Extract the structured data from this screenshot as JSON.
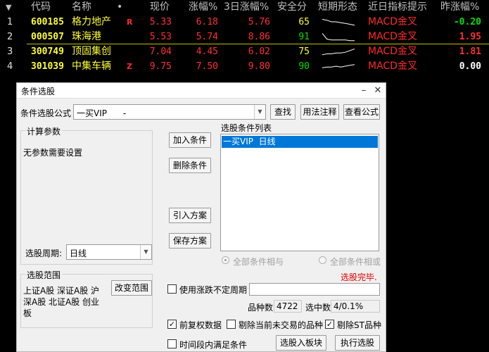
{
  "table": {
    "headers": {
      "sort": "▼",
      "code": "代码",
      "name": "名称",
      "dot": "•",
      "price": "现价",
      "chg": "涨幅%",
      "chg3": "3日涨幅%",
      "safe": "安全分",
      "trend": "短期形态",
      "indicator": "近日指标提示",
      "yest": "昨涨幅%"
    },
    "rows": [
      {
        "idx": "1",
        "code": "600185",
        "name": "格力地产",
        "flag": "R",
        "price": "5.33",
        "chg": "6.18",
        "chg3": "5.76",
        "safe": "65",
        "indicator": "MACD金叉",
        "yest": "-0.20",
        "yest_color": "#00e000",
        "name_color": "#ffff30"
      },
      {
        "idx": "2",
        "code": "000507",
        "name": "珠海港",
        "flag": "",
        "price": "5.53",
        "chg": "5.74",
        "chg3": "8.86",
        "safe": "91",
        "indicator": "MACD金叉",
        "yest": "1.95",
        "yest_color": "#ff3030",
        "name_color": "#ffff30"
      },
      {
        "idx": "3",
        "code": "300749",
        "name": "顶固集创",
        "flag": "",
        "price": "7.04",
        "chg": "4.45",
        "chg3": "6.02",
        "safe": "75",
        "indicator": "MACD金叉",
        "yest": "1.81",
        "yest_color": "#ff3030",
        "name_color": "#ffff30"
      },
      {
        "idx": "4",
        "code": "301039",
        "name": "中集车辆",
        "flag": "Z",
        "price": "9.75",
        "chg": "7.50",
        "chg3": "9.80",
        "safe": "90",
        "indicator": "MACD金叉",
        "yest": "0.00",
        "yest_color": "#ffffff",
        "name_color": "#ffff30"
      }
    ],
    "sparklines": [
      [
        3,
        4,
        6,
        6,
        7,
        8,
        9,
        10
      ],
      [
        2,
        9,
        10,
        10,
        10,
        10,
        11,
        11
      ],
      [
        10,
        9,
        9,
        8,
        8,
        7,
        5,
        3
      ],
      [
        8,
        7,
        7,
        6,
        7,
        6,
        5,
        4
      ]
    ],
    "colors": {
      "up": "#ff3030",
      "code": "#ffff30",
      "safe_good": "#00e000",
      "safe_mid": "#ffff30",
      "indicator": "#ff2a2a"
    }
  },
  "dialog": {
    "title": "条件选股",
    "minimize": "–",
    "close": "✕",
    "formula_label": "条件选股公式",
    "formula_value": "一买VIP      -",
    "find_button": "查找",
    "usage_button": "用法注释",
    "view_button": "查看公式",
    "params_group": "计算参数",
    "params_text": "无参数需要设置",
    "period_label": "选股周期:",
    "period_value": "日线",
    "add_button": "加入条件",
    "delete_button": "删除条件",
    "import_button": "引入方案",
    "save_button": "保存方案",
    "list_group": "选股条件列表",
    "list_items": [
      "一买VIP  日线"
    ],
    "radio_and": "全部条件相与",
    "radio_or": "全部条件相或",
    "status": "选股完毕.",
    "range_group": "选股范围",
    "range_line1": "上证A股 深证A股 沪",
    "range_line2": "深A股 北证A股 创业",
    "range_line3": "板",
    "change_range_button": "改变范围",
    "use_uncertain_label": "使用涨跌不定周期",
    "count_label": "品种数",
    "count_value": "4722",
    "selected_label": "选中数",
    "selected_value": "4/0.1%",
    "prerights_label": "前复权数据",
    "exclude_untraded_label": "剔除当前未交易的品种",
    "exclude_st_label": "剔除ST品种",
    "time_range_label": "时间段内满足条件",
    "add_to_block_button": "选股入板块",
    "execute_button": "执行选股",
    "checks": {
      "use_uncertain": false,
      "prerights": true,
      "exclude_untraded": false,
      "exclude_st": true,
      "time_range": false
    }
  }
}
